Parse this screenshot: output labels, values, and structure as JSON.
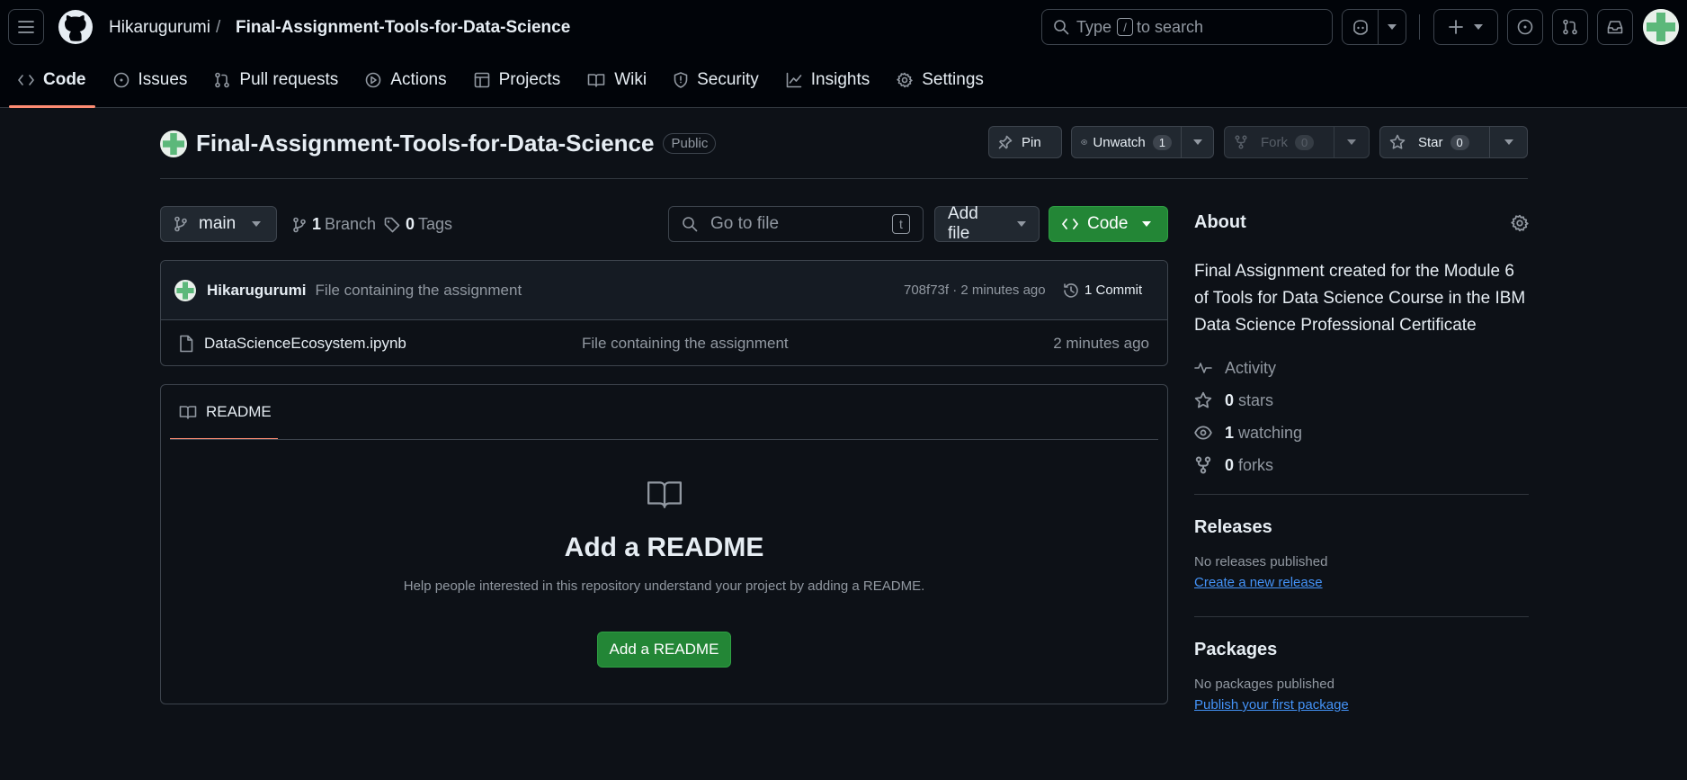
{
  "header": {
    "owner": "Hikarugurumi",
    "separator": "/",
    "repo": "Final-Assignment-Tools-for-Data-Science",
    "search_prefix": "Type",
    "search_key": "/",
    "search_suffix": "to search"
  },
  "tabs": [
    {
      "label": "Code",
      "icon": "code-icon"
    },
    {
      "label": "Issues",
      "icon": "issue-icon"
    },
    {
      "label": "Pull requests",
      "icon": "pull-request-icon"
    },
    {
      "label": "Actions",
      "icon": "play-icon"
    },
    {
      "label": "Projects",
      "icon": "table-icon"
    },
    {
      "label": "Wiki",
      "icon": "book-icon"
    },
    {
      "label": "Security",
      "icon": "shield-icon"
    },
    {
      "label": "Insights",
      "icon": "graph-icon"
    },
    {
      "label": "Settings",
      "icon": "gear-icon"
    }
  ],
  "repo": {
    "name": "Final-Assignment-Tools-for-Data-Science",
    "visibility": "Public",
    "pin_label": "Pin",
    "unwatch_label": "Unwatch",
    "watch_count": "1",
    "fork_label": "Fork",
    "fork_count": "0",
    "star_label": "Star",
    "star_count": "0"
  },
  "toolbar": {
    "branch": "main",
    "branch_count": "1",
    "branch_label": "Branch",
    "tag_count": "0",
    "tag_label": "Tags",
    "goto_placeholder": "Go to file",
    "goto_key": "t",
    "add_file": "Add file",
    "code": "Code"
  },
  "commit": {
    "author": "Hikarugurumi",
    "message": "File containing the assignment",
    "meta": "708f73f · 2 minutes ago",
    "commits": "1 Commit"
  },
  "files": [
    {
      "name": "DataScienceEcosystem.ipynb",
      "message": "File containing the assignment",
      "time": "2 minutes ago"
    }
  ],
  "readme": {
    "tab": "README",
    "title": "Add a README",
    "desc": "Help people interested in this repository understand your project by adding a README.",
    "button": "Add a README"
  },
  "about": {
    "title": "About",
    "description": "Final Assignment created for the Module 6 of Tools for Data Science Course in the IBM Data Science Professional Certificate",
    "activity": "Activity",
    "stars_count": "0",
    "stars_label": "stars",
    "watching_count": "1",
    "watching_label": "watching",
    "forks_count": "0",
    "forks_label": "forks"
  },
  "releases": {
    "title": "Releases",
    "text": "No releases published",
    "link": "Create a new release"
  },
  "packages": {
    "title": "Packages",
    "text": "No packages published",
    "link": "Publish your first package"
  },
  "colors": {
    "background": "#0d1117",
    "header": "#010409",
    "accent_underline": "#fd8c73",
    "green_button": "#238636",
    "link": "#4493f8"
  }
}
